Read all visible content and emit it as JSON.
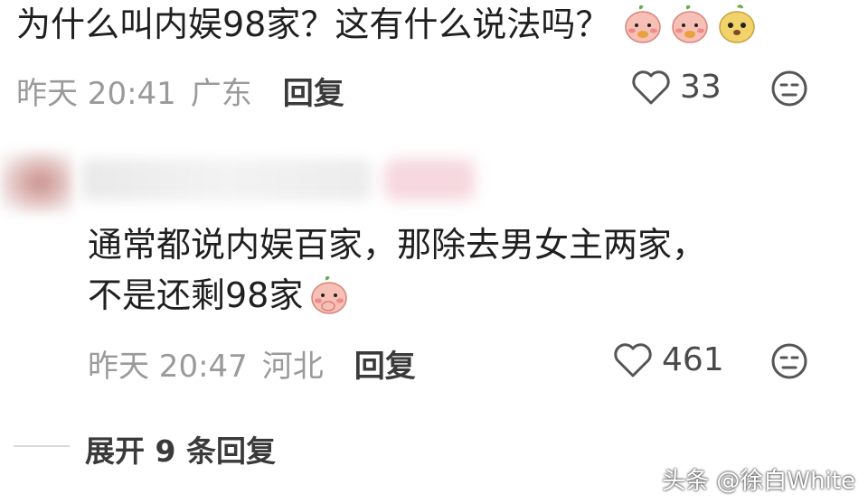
{
  "comment1": {
    "text": "为什么叫内娱98家？这有什么说法吗？",
    "emojis": [
      "peach-face-emoji",
      "peach-face-emoji",
      "yellow-dog-face-emoji"
    ],
    "time": "昨天 20:41",
    "location": "广东",
    "reply_label": "回复",
    "likes": "33"
  },
  "comment2": {
    "line1": "通常都说内娱百家，那除去男女主两家，",
    "line2": "不是还剩98家",
    "emoji": "peach-face-emoji",
    "time": "昨天 20:47",
    "location": "河北",
    "reply_label": "回复",
    "likes": "461"
  },
  "expand_replies": "展开 9 条回复",
  "watermark": "头条 @徐白White",
  "colors": {
    "meta": "#9a9a9a",
    "text": "#1f1f1f",
    "peach": "#f4b8b0",
    "yellow": "#f2d36b"
  }
}
